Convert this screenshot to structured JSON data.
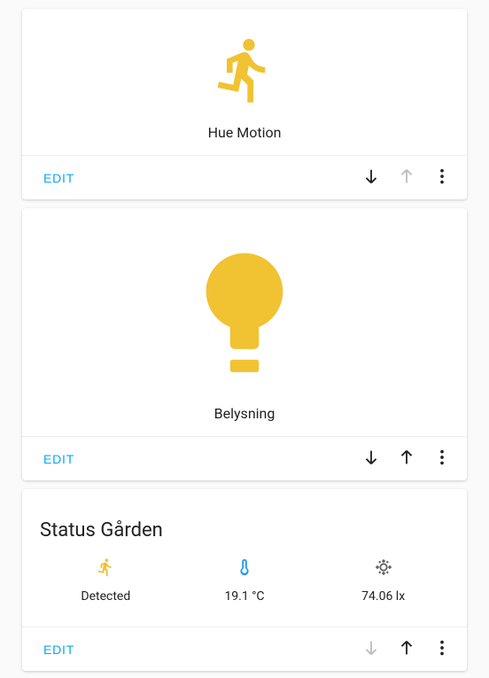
{
  "colors": {
    "accent_yellow": "#f1c232",
    "link_blue": "#03a9f4",
    "text": "#212121",
    "muted": "#bdbdbd"
  },
  "cards": [
    {
      "id": "motion",
      "label": "Hue Motion",
      "icon": "running-person",
      "edit_label": "EDIT",
      "move_down_enabled": true,
      "move_up_enabled": false
    },
    {
      "id": "light",
      "label": "Belysning",
      "icon": "lightbulb",
      "edit_label": "EDIT",
      "move_down_enabled": true,
      "move_up_enabled": true
    },
    {
      "id": "status",
      "title": "Status Gården",
      "edit_label": "EDIT",
      "move_down_enabled": false,
      "move_up_enabled": true,
      "items": [
        {
          "icon": "running-person",
          "value": "Detected"
        },
        {
          "icon": "thermometer",
          "value": "19.1 °C"
        },
        {
          "icon": "brightness",
          "value": "74.06 lx"
        }
      ]
    }
  ]
}
